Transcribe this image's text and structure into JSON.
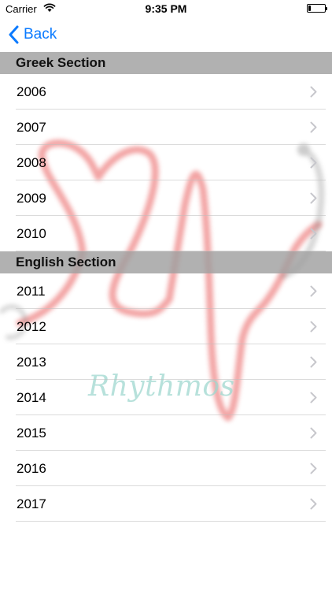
{
  "status_bar": {
    "carrier": "Carrier",
    "time": "9:35 PM",
    "battery_level": 0.15
  },
  "nav": {
    "back_label": "Back"
  },
  "watermark": {
    "text": "Rhythmos"
  },
  "sections": [
    {
      "title": "Greek Section",
      "rows": [
        "2006",
        "2007",
        "2008",
        "2009",
        "2010"
      ]
    },
    {
      "title": "English Section",
      "rows": [
        "2011",
        "2012",
        "2013",
        "2014",
        "2015",
        "2016",
        "2017"
      ]
    }
  ],
  "colors": {
    "accent": "#0a7aff",
    "section_header": "#a0a0a0",
    "heart": "#e85a5a",
    "watermark_text": "#9fd8cf"
  },
  "icons": {
    "back": "chevron-left-icon",
    "row_disclosure": "chevron-right-icon",
    "wifi": "wifi-icon",
    "battery": "battery-icon"
  }
}
